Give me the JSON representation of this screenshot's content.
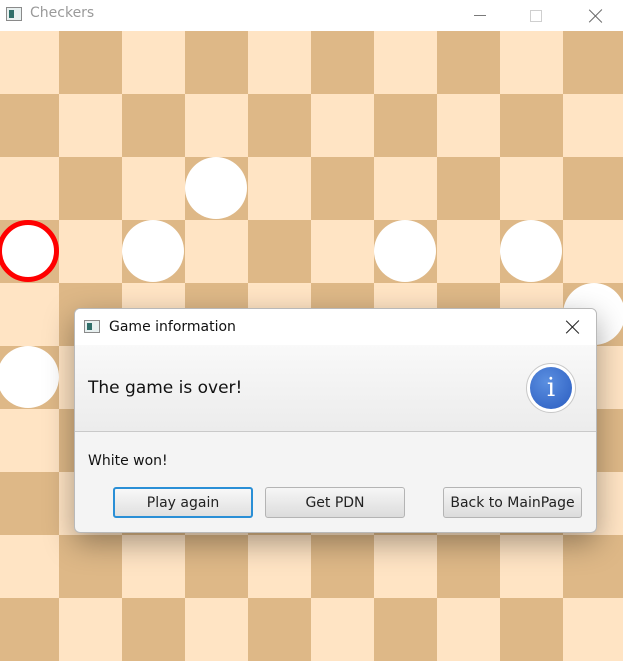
{
  "window": {
    "title": "Checkers"
  },
  "board": {
    "rows": 10,
    "cols": 10,
    "light_color": "#ffe4c4",
    "dark_color": "#deb887",
    "piece_color": "#ffffff",
    "selected_ring_color": "#ff0000"
  },
  "dialog": {
    "title": "Game information",
    "header": "The game is over!",
    "content": "White won!",
    "buttons": {
      "play_again": "Play again",
      "get_pdn": "Get PDN",
      "back_to_main": "Back to MainPage"
    },
    "icon": "info-icon",
    "info_glyph": "i"
  }
}
